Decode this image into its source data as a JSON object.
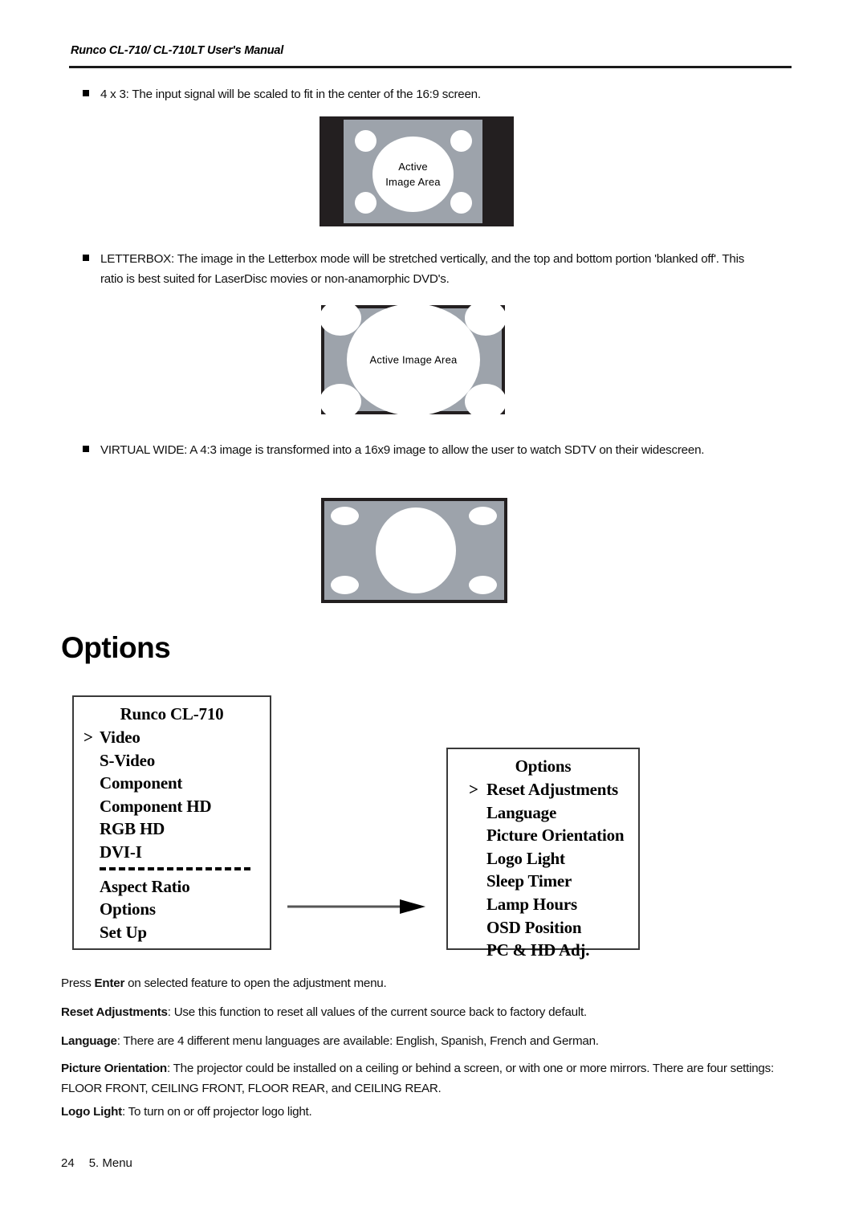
{
  "header": {
    "running_title": "Runco CL-710/ CL-710LT User's Manual"
  },
  "bullets": [
    {
      "id": "four-by-three",
      "text": "4 x 3:  The input signal will be scaled to fit in the center of the 16:9 screen."
    },
    {
      "id": "letterbox",
      "text": "LETTERBOX: The image in the Letterbox mode will be stretched vertically, and the top and bottom portion 'blanked off'. This ratio is best suited for LaserDisc movies or non-anamorphic DVD's."
    },
    {
      "id": "virtual-wide",
      "text": "VIRTUAL WIDE: A 4:3 image is transformed into a 16x9 image to allow the user to watch SDTV on their widescreen."
    }
  ],
  "diagrams": [
    {
      "id": "diagram-4x3",
      "label_line1": "Active",
      "label_line2": "Image Area",
      "frame_color": "#231f20",
      "field_color": "#9da3ab",
      "blob_color": "#ffffff"
    },
    {
      "id": "diagram-letterbox",
      "label": "Active Image Area",
      "frame_color": "#231f20",
      "field_color": "#9da3ab",
      "blob_color": "#ffffff"
    },
    {
      "id": "diagram-virtual-wide",
      "label": "",
      "frame_color": "#231f20",
      "field_color": "#9da3ab",
      "blob_color": "#ffffff"
    }
  ],
  "section": {
    "heading": "Options"
  },
  "osd_left": {
    "title": "Runco CL-710",
    "caret": ">",
    "items_top": [
      {
        "label": "Video",
        "selected": true
      },
      {
        "label": "S-Video",
        "selected": false
      },
      {
        "label": "Component",
        "selected": false
      },
      {
        "label": "Component HD",
        "selected": false
      },
      {
        "label": "RGB HD",
        "selected": false
      },
      {
        "label": "DVI-I",
        "selected": false
      }
    ],
    "items_bottom": [
      {
        "label": "Aspect Ratio",
        "selected": false
      },
      {
        "label": "Options",
        "selected": false
      },
      {
        "label": "Set Up",
        "selected": false
      }
    ]
  },
  "osd_right": {
    "title": "Options",
    "caret": ">",
    "items": [
      {
        "label": "Reset Adjustments",
        "selected": true
      },
      {
        "label": "Language",
        "selected": false
      },
      {
        "label": "Picture Orientation",
        "selected": false
      },
      {
        "label": "Logo Light",
        "selected": false
      },
      {
        "label": "Sleep Timer",
        "selected": false
      },
      {
        "label": "Lamp Hours",
        "selected": false
      },
      {
        "label": "OSD Position",
        "selected": false
      },
      {
        "label": "PC & HD Adj.",
        "selected": false
      }
    ]
  },
  "body": {
    "press_enter": {
      "lead": "Press ",
      "bold": "Enter",
      "rest": " on selected feature to open the adjustment menu."
    },
    "reset_adjustments": {
      "term": "Reset Adjustments",
      "text": ": Use this function to reset all values of the current source back to factory default."
    },
    "language": {
      "term": "Language",
      "text": ": There are 4 different menu languages are available: English, Spanish, French and German."
    },
    "picture_orientation": {
      "term": "Picture Orientation",
      "text": ": The projector could be installed on a ceiling or behind a screen, or with one or more mirrors. There are four settings: FLOOR FRONT, CEILING FRONT, FLOOR REAR, and CEILING REAR."
    },
    "logo_light": {
      "term": "Logo Light",
      "text": ": To turn on or off projector logo light."
    }
  },
  "footer": {
    "page_number": "24",
    "chapter": "5. Menu"
  }
}
